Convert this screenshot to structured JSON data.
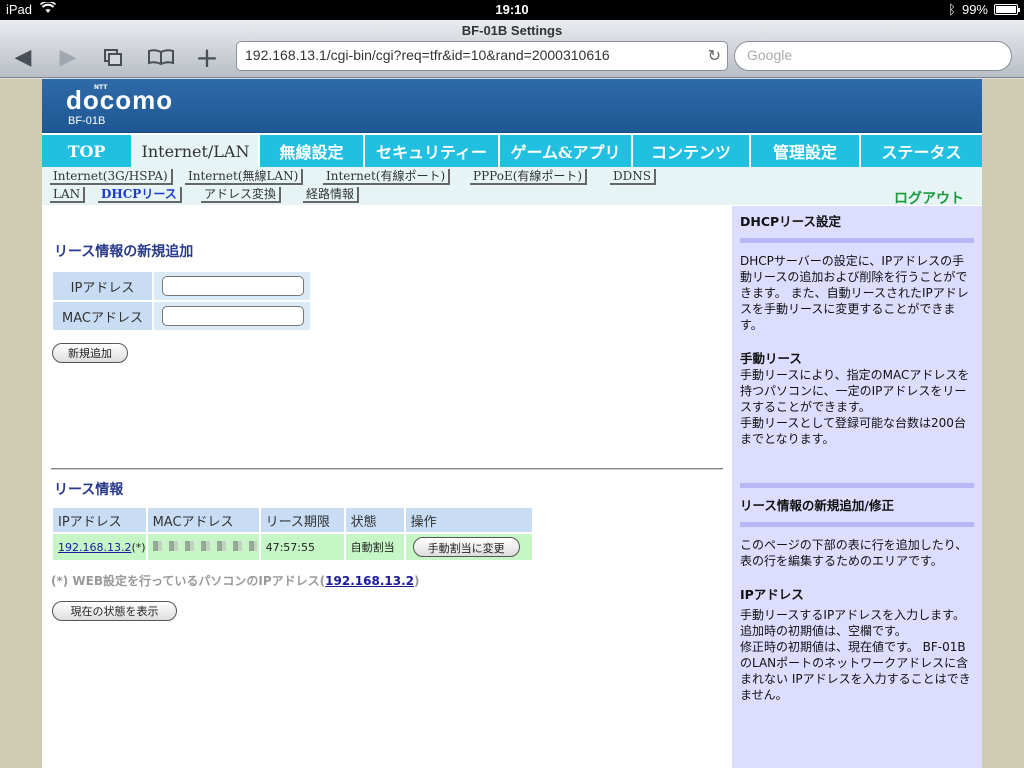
{
  "status_bar": {
    "device": "iPad",
    "time": "19:10",
    "battery": "99%"
  },
  "browser": {
    "page_title": "BF-01B Settings",
    "url": "192.168.13.1/cgi-bin/cgi?req=tfr&id=10&rand=2000310616",
    "search_placeholder": "Google"
  },
  "header": {
    "logo": "docomo",
    "logo_sup": "NTT",
    "model": "BF-01B"
  },
  "main_nav": [
    "TOP",
    "Internet/LAN",
    "無線設定",
    "セキュリティー",
    "ゲーム&アプリ",
    "コンテンツ",
    "管理設定",
    "ステータス"
  ],
  "sub_nav": {
    "row1": [
      "Internet(3G/HSPA)",
      "Internet(無線LAN)",
      "Internet(有線ポート)",
      "PPPoE(有線ポート)",
      "DDNS"
    ],
    "row2": [
      "LAN",
      "DHCPリース",
      "アドレス変換",
      "経路情報"
    ],
    "logout": "ログアウト"
  },
  "add_section": {
    "title": "リース情報の新規追加",
    "ip_label": "IPアドレス",
    "mac_label": "MACアドレス",
    "ip_value": "",
    "mac_value": "",
    "add_button": "新規追加"
  },
  "lease_section": {
    "title": "リース情報",
    "columns": [
      "IPアドレス",
      "MACアドレス",
      "リース期限",
      "状態",
      "操作"
    ],
    "row": {
      "ip": "192.168.13.2",
      "ip_suffix": "(*)",
      "expiry": "47:57:55",
      "state": "自動割当",
      "action": "手動割当に変更"
    },
    "note_prefix": "(*) WEB設定を行っているパソコンのIPアドレス(",
    "note_ip": "192.168.13.2",
    "note_suffix": ")",
    "refresh_button": "現在の状態を表示"
  },
  "help": {
    "h1": "DHCPリース設定",
    "p1": "DHCPサーバーの設定に、IPアドレスの手動リースの追加および削除を行うことができます。 また、自動リースされたIPアドレスを手動リースに変更することができます。",
    "h2": "手動リース",
    "p2": "手動リースにより、指定のMACアドレスを持つパソコンに、一定のIPアドレスをリースすることができます。",
    "p3": "手動リースとして登録可能な台数は200台までとなります。",
    "h3": "リース情報の新規追加/修正",
    "p4": "このページの下部の表に行を追加したり、 表の行を編集するためのエリアです。",
    "h4": "IPアドレス",
    "p5": "手動リースするIPアドレスを入力します。",
    "p6": "追加時の初期値は、空欄です。",
    "p7": "修正時の初期値は、現在値です。 BF-01BのLANポートのネットワークアドレスに含まれない IPアドレスを入力することはできません。"
  },
  "colors": {
    "nav": "#22c0e0",
    "header": "#2f6aa8",
    "help_bg": "#dcddff",
    "lease_row": "#c6f5c6"
  }
}
